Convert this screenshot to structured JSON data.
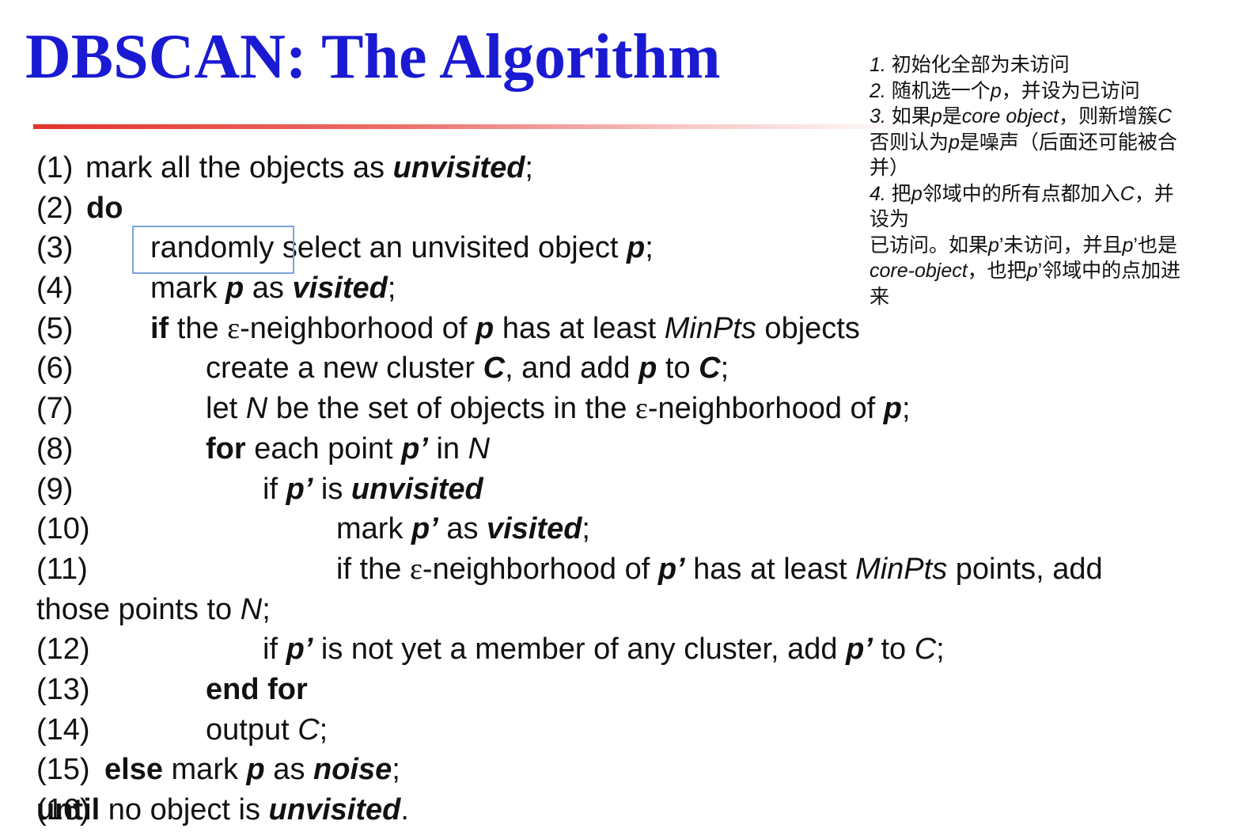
{
  "title": "DBSCAN: The Algorithm",
  "note": [
    [
      {
        "t": "1. ",
        "s": "i"
      },
      {
        "t": "初始化全部为未访问"
      }
    ],
    [
      {
        "t": "2. ",
        "s": "i"
      },
      {
        "t": "随机选一个"
      },
      {
        "t": "p",
        "s": "i"
      },
      {
        "t": "，并设为已访问"
      }
    ],
    [
      {
        "t": "3. ",
        "s": "i"
      },
      {
        "t": "如果"
      },
      {
        "t": "p",
        "s": "i"
      },
      {
        "t": "是"
      },
      {
        "t": "core object",
        "s": "i"
      },
      {
        "t": "，则新增簇"
      },
      {
        "t": "C",
        "s": "i"
      }
    ],
    [
      {
        "t": "否则认为"
      },
      {
        "t": "p",
        "s": "i"
      },
      {
        "t": "是噪声（后面还可能被合"
      }
    ],
    [
      {
        "t": "并）"
      }
    ],
    [
      {
        "t": "4. ",
        "s": "i"
      },
      {
        "t": "把"
      },
      {
        "t": "p",
        "s": "i"
      },
      {
        "t": "邻域中的所有点都加入"
      },
      {
        "t": "C",
        "s": "i"
      },
      {
        "t": "，并"
      }
    ],
    [
      {
        "t": "设为"
      }
    ],
    [
      {
        "t": "已访问。如果"
      },
      {
        "t": "p",
        "s": "i"
      },
      {
        "t": "’未访问，并且"
      },
      {
        "t": "p",
        "s": "i"
      },
      {
        "t": "’也是"
      }
    ],
    [
      {
        "t": "core-object",
        "s": "i"
      },
      {
        "t": "，也把"
      },
      {
        "t": "p",
        "s": "i"
      },
      {
        "t": "’邻域中的点加进"
      }
    ],
    [
      {
        "t": "来"
      }
    ]
  ],
  "lines": [
    {
      "num": "(1)",
      "indent": 0,
      "parts": [
        {
          "t": "mark all the objects as "
        },
        {
          "t": "unvisited",
          "s": "bi"
        },
        {
          "t": ";"
        }
      ]
    },
    {
      "num": "(2)",
      "indent": 0,
      "parts": [
        {
          "t": "do",
          "s": "b"
        }
      ]
    },
    {
      "num": "(3)",
      "indent": 1,
      "parts": [
        {
          "t": "randomly select an unvisited object "
        },
        {
          "t": "p",
          "s": "bi"
        },
        {
          "t": ";"
        }
      ]
    },
    {
      "num": "(4)",
      "indent": 1,
      "parts": [
        {
          "t": "mark "
        },
        {
          "t": "p",
          "s": "bi"
        },
        {
          "t": " as "
        },
        {
          "t": "visited",
          "s": "bi"
        },
        {
          "t": ";"
        }
      ]
    },
    {
      "num": "(5)",
      "indent": 1,
      "parts": [
        {
          "t": "if",
          "s": "b"
        },
        {
          "t": " the "
        },
        {
          "t": "ε",
          "s": "g"
        },
        {
          "t": "-neighborhood of "
        },
        {
          "t": "p",
          "s": "bi"
        },
        {
          "t": " has at least "
        },
        {
          "t": "MinPts",
          "s": "i"
        },
        {
          "t": " objects"
        }
      ]
    },
    {
      "num": "(6)",
      "indent": 2,
      "parts": [
        {
          "t": "create a new cluster "
        },
        {
          "t": "C",
          "s": "bi"
        },
        {
          "t": ", and add "
        },
        {
          "t": "p",
          "s": "bi"
        },
        {
          "t": " to "
        },
        {
          "t": "C",
          "s": "bi"
        },
        {
          "t": ";"
        }
      ]
    },
    {
      "num": "(7)",
      "indent": 2,
      "parts": [
        {
          "t": "let "
        },
        {
          "t": "N",
          "s": "i"
        },
        {
          "t": " be the set of objects in the "
        },
        {
          "t": "ε",
          "s": "g"
        },
        {
          "t": "-neighborhood of "
        },
        {
          "t": "p",
          "s": "bi"
        },
        {
          "t": ";"
        }
      ]
    },
    {
      "num": "(8)",
      "indent": 2,
      "parts": [
        {
          "t": "for",
          "s": "b"
        },
        {
          "t": " each point "
        },
        {
          "t": "p’",
          "s": "bi"
        },
        {
          "t": " in "
        },
        {
          "t": "N",
          "s": "i"
        }
      ]
    },
    {
      "num": "(9)",
      "indent": 3,
      "parts": [
        {
          "t": "if "
        },
        {
          "t": "p’",
          "s": "bi"
        },
        {
          "t": " is "
        },
        {
          "t": "unvisited",
          "s": "bi"
        }
      ]
    },
    {
      "num": "(10)",
      "indent": 4,
      "parts": [
        {
          "t": "mark "
        },
        {
          "t": "p’",
          "s": "bi"
        },
        {
          "t": " as "
        },
        {
          "t": "visited",
          "s": "bi"
        },
        {
          "t": ";"
        }
      ]
    },
    {
      "num": "(11)",
      "indent": 4,
      "parts": [
        {
          "t": "if the "
        },
        {
          "t": "ε",
          "s": "g"
        },
        {
          "t": "-neighborhood of "
        },
        {
          "t": "p’",
          "s": "bi"
        },
        {
          "t": " has at least "
        },
        {
          "t": "MinPts",
          "s": "i"
        },
        {
          "t": " points, add"
        }
      ]
    },
    {
      "num": "",
      "indent": 0,
      "parts": [
        {
          "t": "those points to "
        },
        {
          "t": "N",
          "s": "i"
        },
        {
          "t": ";"
        }
      ]
    },
    {
      "num": "(12)",
      "indent": 3,
      "parts": [
        {
          "t": "if "
        },
        {
          "t": "p’",
          "s": "bi"
        },
        {
          "t": " is not yet a member of any cluster, add "
        },
        {
          "t": "p’",
          "s": "bi"
        },
        {
          "t": " to "
        },
        {
          "t": "C",
          "s": "i"
        },
        {
          "t": ";"
        }
      ]
    },
    {
      "num": "(13)",
      "indent": 2,
      "parts": [
        {
          "t": "end for",
          "s": "b"
        }
      ]
    },
    {
      "num": "(14)",
      "indent": 2,
      "parts": [
        {
          "t": "output "
        },
        {
          "t": "C",
          "s": "i"
        },
        {
          "t": ";"
        }
      ]
    },
    {
      "num": "(15)",
      "indent": 1,
      "parts": [
        {
          "t": "else",
          "s": "b"
        },
        {
          "t": " mark "
        },
        {
          "t": "p",
          "s": "bi"
        },
        {
          "t": " as "
        },
        {
          "t": "noise",
          "s": "bi"
        },
        {
          "t": ";"
        }
      ]
    },
    {
      "num": "(16)",
      "indent": 0,
      "parts": [
        {
          "t": "until",
          "s": "b"
        },
        {
          "t": " no object is "
        },
        {
          "t": "unvisited",
          "s": "bi"
        },
        {
          "t": "."
        }
      ]
    }
  ]
}
